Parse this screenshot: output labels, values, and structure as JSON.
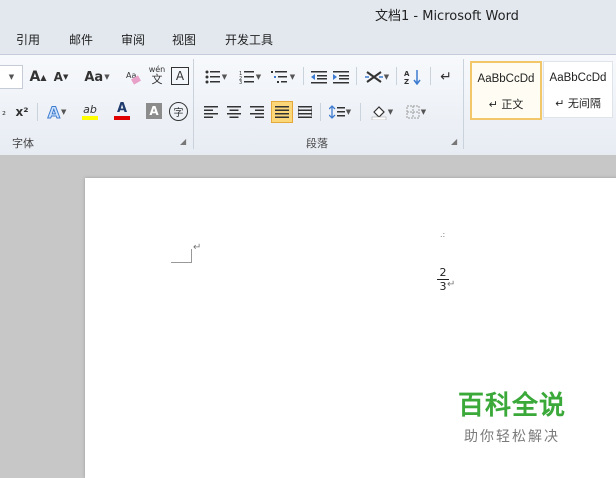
{
  "window": {
    "title": "文档1 - Microsoft Word"
  },
  "tabs": [
    "引用",
    "邮件",
    "审阅",
    "视图",
    "开发工具"
  ],
  "font_group": {
    "label": "字体",
    "grow_font": "A",
    "shrink_font": "A",
    "change_case": "Aa",
    "phonetic_guide": "wén",
    "char_border": "A",
    "superscript": "x²",
    "text_effects": "A",
    "highlight": "ab",
    "font_color": "A",
    "char_shading": "A",
    "enclose_char": "字"
  },
  "paragraph_group": {
    "label": "段落"
  },
  "styles": [
    {
      "sample": "AaBbCcDd",
      "name": "↵ 正文"
    },
    {
      "sample": "AaBbCcDd",
      "name": "↵ 无间隔"
    }
  ],
  "document": {
    "numerator": "2",
    "denominator": "3",
    "paragraph_mark": "↵",
    "formula_mark": ".:"
  },
  "watermark": {
    "title": "百科全说",
    "subtitle": "助你轻松解决"
  },
  "colors": {
    "highlight_yellow": "#ffff00",
    "font_red": "#e00000",
    "watermark_green": "#3aa93a"
  }
}
